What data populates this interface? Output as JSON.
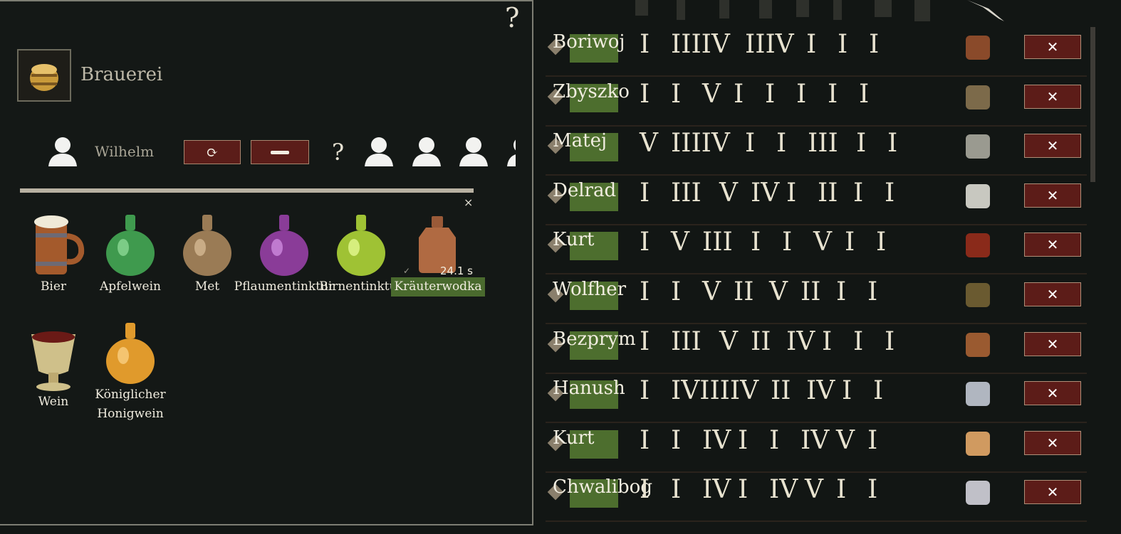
{
  "building": {
    "title": "Brauerei",
    "help": "?"
  },
  "worker": {
    "name": "Wilhelm",
    "help": "?"
  },
  "recipes": [
    {
      "label": "Bier",
      "icon": "beer-mug-icon"
    },
    {
      "label": "Apfelwein",
      "icon": "green-jug-icon"
    },
    {
      "label": "Met",
      "icon": "brown-jug-icon"
    },
    {
      "label": "Pflaumentinktur",
      "icon": "purple-jug-icon"
    },
    {
      "label": "Birnentinktur",
      "icon": "lime-jug-icon"
    },
    {
      "label": "Kräuterwodka",
      "icon": "flask-icon"
    },
    {
      "label": "Wein",
      "icon": "wine-cup-icon"
    },
    {
      "label": "Königlicher",
      "label2": "Honigwein",
      "icon": "orange-jug-icon"
    }
  ],
  "active": {
    "timer": "24.1 s",
    "check": "✓"
  },
  "close": "×",
  "workers": [
    {
      "name": "Boriwoj",
      "skills": [
        "I",
        "IIIIV",
        "IIIV",
        "I",
        "I",
        "I"
      ],
      "icon": "boot-icon"
    },
    {
      "name": "Zbyszko",
      "skills": [
        "I",
        "I",
        "V",
        "I",
        "I",
        "I",
        "I",
        "I"
      ],
      "icon": "woodcutter-icon"
    },
    {
      "name": "Matej",
      "skills": [
        "V",
        "IIIIV",
        "I",
        "I",
        "III",
        "I",
        "I"
      ],
      "icon": "shield-icon"
    },
    {
      "name": "Delrad",
      "skills": [
        "I",
        "III",
        "V",
        "IV",
        "I",
        "II",
        "I",
        "I"
      ],
      "icon": "sickle-icon"
    },
    {
      "name": "Kurt",
      "skills": [
        "I",
        "V",
        "III",
        "I",
        "I",
        "V",
        "I",
        "I"
      ],
      "icon": "rooster-icon"
    },
    {
      "name": "Wolfher",
      "skills": [
        "I",
        "I",
        "V",
        "II",
        "V",
        "II",
        "I",
        "I"
      ],
      "icon": "deer-icon"
    },
    {
      "name": "Bezprym",
      "skills": [
        "I",
        "III",
        "V",
        "II",
        "IV",
        "I",
        "I",
        "I"
      ],
      "icon": "leather-icon"
    },
    {
      "name": "Hanush",
      "skills": [
        "I",
        "IVIIIIV",
        "II",
        "IV",
        "I",
        "I"
      ],
      "icon": "cleaver-icon"
    },
    {
      "name": "Kurt",
      "skills": [
        "I",
        "I",
        "IV",
        "I",
        "I",
        "IV",
        "V",
        "I"
      ],
      "icon": "baker-icon"
    },
    {
      "name": "Chwalibog",
      "skills": [
        "I",
        "I",
        "IV",
        "I",
        "IV",
        "V",
        "I",
        "I"
      ],
      "icon": "axe-icon"
    }
  ],
  "remove_label": "✕"
}
